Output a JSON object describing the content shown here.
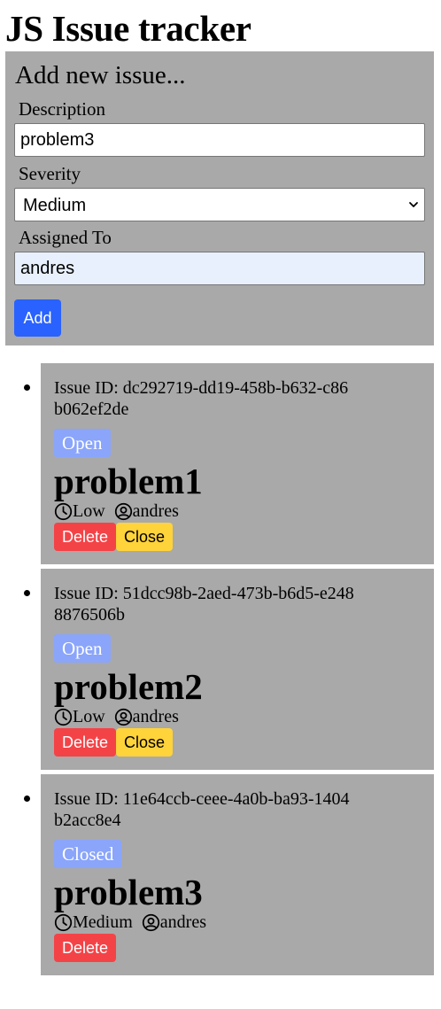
{
  "page": {
    "title": "JS Issue tracker"
  },
  "form": {
    "heading": "Add new issue...",
    "description_label": "Description",
    "description_value": "problem3",
    "severity_label": "Severity",
    "severity_value": "Medium",
    "assigned_label": "Assigned To",
    "assigned_value": "andres",
    "add_label": "Add"
  },
  "issues": [
    {
      "id_text": "Issue ID: dc292719-dd19-458b-b632-c86b062ef2de",
      "status": "Open",
      "title": "problem1",
      "severity": "Low",
      "assignee": "andres",
      "delete_label": "Delete",
      "close_label": "Close"
    },
    {
      "id_text": "Issue ID: 51dcc98b-2aed-473b-b6d5-e2488876506b",
      "status": "Open",
      "title": "problem2",
      "severity": "Low",
      "assignee": "andres",
      "delete_label": "Delete",
      "close_label": "Close"
    },
    {
      "id_text": "Issue ID: 11e64ccb-ceee-4a0b-ba93-1404b2acc8e4",
      "status": "Closed",
      "title": "problem3",
      "severity": "Medium",
      "assignee": "andres",
      "delete_label": "Delete"
    }
  ],
  "icons": {
    "severity": "clock-icon",
    "assignee": "user-circle-icon"
  },
  "colors": {
    "panel": "#a9a9a9",
    "add_button": "#2962ff",
    "status_badge": "#8aa5fa",
    "delete_button": "#f44347",
    "close_button": "#ffd33a"
  }
}
